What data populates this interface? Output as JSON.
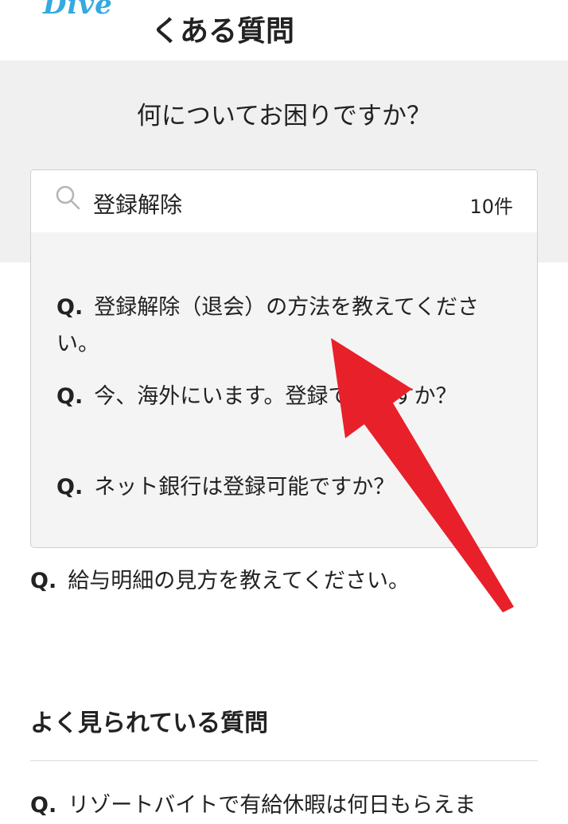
{
  "header": {
    "logo_text": "Dive",
    "title": "くある質問"
  },
  "search": {
    "heading": "何についてお困りですか？",
    "query": "登録解除",
    "result_count": "10件",
    "suggestions": [
      {
        "q": "Q.",
        "text": "登録解除（退会）の方法を教えてください。"
      },
      {
        "q": "Q.",
        "text": "今、海外にいます。登録できますか？"
      },
      {
        "q": "Q.",
        "text": "ネット銀行は登録可能ですか？"
      }
    ]
  },
  "faq": {
    "q": "Q.",
    "text": "給与明細の見方を教えてください。"
  },
  "popular": {
    "title": "よく見られている質問",
    "items": [
      {
        "q": "Q.",
        "text": "リゾートバイトで有給休暇は何日もらえま"
      }
    ]
  },
  "annotation": {
    "arrow_color": "#e8202a"
  },
  "colors": {
    "brand": "#35a9e0",
    "search_panel": "#f0f0f0"
  }
}
